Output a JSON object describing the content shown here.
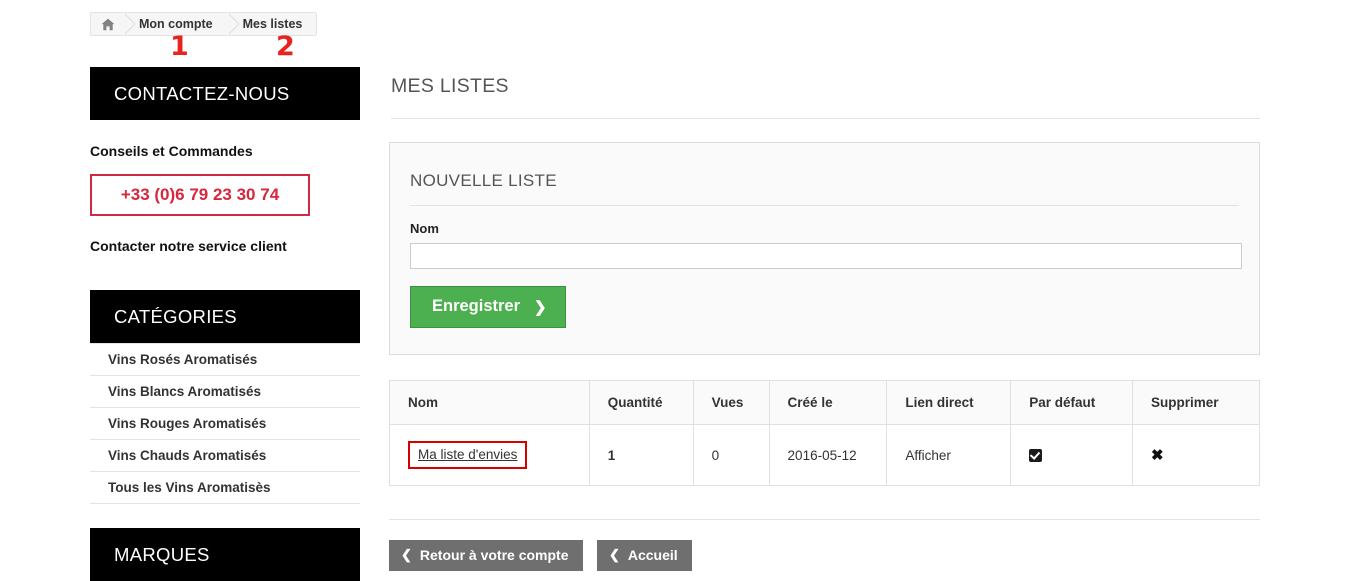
{
  "breadcrumb": {
    "home_icon": "home-icon",
    "items": [
      {
        "label": "Mon compte"
      },
      {
        "label": "Mes listes"
      }
    ]
  },
  "annotations": [
    {
      "label": "1"
    },
    {
      "label": "2"
    }
  ],
  "sidebar": {
    "contact": {
      "title": "CONTACTEZ-NOUS",
      "lead": "Conseils et Commandes",
      "phone": "+33 (0)6 79 23 30 74",
      "service_link": "Contacter notre service client"
    },
    "categories": {
      "title": "CATÉGORIES",
      "items": [
        {
          "label": "Vins Rosés Aromatisés"
        },
        {
          "label": "Vins Blancs Aromatisés"
        },
        {
          "label": "Vins Rouges Aromatisés"
        },
        {
          "label": "Vins Chauds Aromatisés"
        },
        {
          "label": "Tous les Vins Aromatisès"
        }
      ]
    },
    "brands": {
      "title": "MARQUES"
    }
  },
  "main": {
    "page_title": "MES LISTES",
    "new_list": {
      "heading": "NOUVELLE LISTE",
      "name_label": "Nom",
      "name_value": "",
      "name_placeholder": "",
      "save_label": "Enregistrer",
      "save_chevron": "❯"
    },
    "table": {
      "columns": [
        {
          "label": "Nom"
        },
        {
          "label": "Quantité"
        },
        {
          "label": "Vues"
        },
        {
          "label": "Créé le"
        },
        {
          "label": "Lien direct"
        },
        {
          "label": "Par défaut"
        },
        {
          "label": "Supprimer"
        }
      ],
      "rows": [
        {
          "nom": "Ma liste d'envies",
          "quantite": "1",
          "vues": "0",
          "cree_le": "2016-05-12",
          "lien_direct": "Afficher",
          "par_defaut_checked": true,
          "supprimer_icon": "✖"
        }
      ]
    },
    "footer": {
      "back_label": "Retour à votre compte",
      "home_label": "Accueil",
      "chevron_left": "❮"
    }
  },
  "colors": {
    "accent_red": "#d8263c",
    "annotation_red": "#e8231f",
    "save_green": "#4caf50",
    "gray_button": "#6f6f6f",
    "block_header": "#000000"
  }
}
